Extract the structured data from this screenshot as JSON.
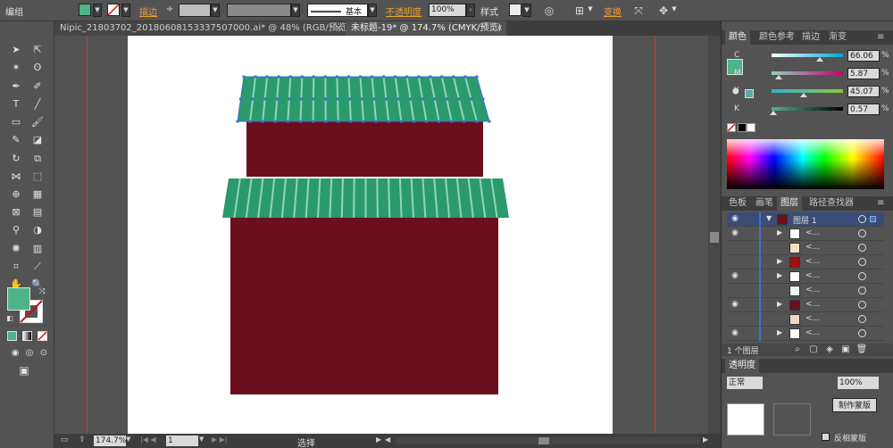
{
  "control_bar": {
    "mode_label": "编组",
    "fill_color": "#4fb38a",
    "stroke_label": "描边",
    "stroke_value": "",
    "stroke_style": "",
    "brush_label": "基本",
    "opacity_label": "不透明度",
    "opacity_value": "100%",
    "style_label": "样式",
    "transform_label": "变换"
  },
  "tabs": [
    {
      "label": "Nipic_21803702_20180608153337507000.ai* @ 48% (RGB/预览)",
      "close": "×"
    },
    {
      "label": "未标题-19* @ 174.7% (CMYK/预览)",
      "close": "×"
    }
  ],
  "status_bar": {
    "zoom": "174.7%",
    "page": "1",
    "tool_status": "选择"
  },
  "color_panel": {
    "tabs": [
      "颜色",
      "颜色参考",
      "描边",
      "渐变"
    ],
    "fill_color": "#4fb38a",
    "sliders": [
      {
        "label": "C",
        "value": "66.06",
        "pct": "%",
        "color": "#00a8c8"
      },
      {
        "label": "M",
        "value": "5.87",
        "pct": "%",
        "color": "#c8006e"
      },
      {
        "label": "Y",
        "value": "45.07",
        "pct": "%",
        "color": "#e0d800"
      },
      {
        "label": "K",
        "value": "0.57",
        "pct": "%",
        "color": "#777777"
      }
    ]
  },
  "layers_panel": {
    "tabs": [
      "色板",
      "画笔",
      "图层",
      "路径查找器"
    ],
    "layer_name": "图层 1",
    "sublayers": [
      {
        "name": "<...",
        "visible": true
      },
      {
        "name": "<...",
        "visible": false
      },
      {
        "name": "<...",
        "visible": false
      },
      {
        "name": "<...",
        "visible": true
      },
      {
        "name": "<...",
        "visible": false
      },
      {
        "name": "<...",
        "visible": true
      },
      {
        "name": "<...",
        "visible": false
      },
      {
        "name": "<...",
        "visible": true
      }
    ],
    "count_label": "1 个图层"
  },
  "transparency_panel": {
    "tab": "透明度",
    "mode": "正常",
    "opacity": "100%",
    "mask_button": "制作蒙版",
    "invert_label": "反相蒙版"
  },
  "artwork": {
    "roof_color": "#2a9a6e",
    "stripe_color": "#8ed6b6",
    "wall_color": "#6b0f1e"
  }
}
